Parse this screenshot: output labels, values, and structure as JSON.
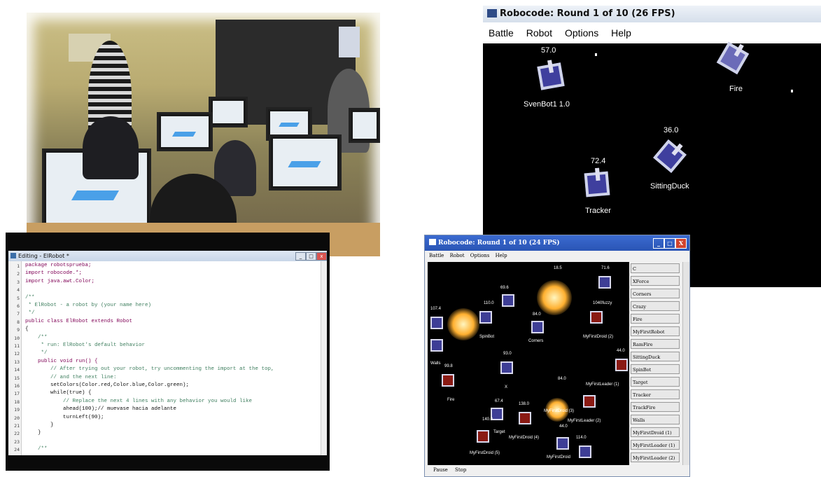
{
  "editor": {
    "title": "Editing - ElRobot *",
    "lines": [
      {
        "n": "1",
        "text": "package robotsprueba;"
      },
      {
        "n": "2",
        "text": "import robocode.*;"
      },
      {
        "n": "3",
        "text": "import java.awt.Color;"
      },
      {
        "n": "4",
        "text": ""
      },
      {
        "n": "5",
        "text": "/**"
      },
      {
        "n": "6",
        "text": " * ElRobot - a robot by (your name here)"
      },
      {
        "n": "7",
        "text": " */"
      },
      {
        "n": "8",
        "text": "public class ElRobot extends Robot"
      },
      {
        "n": "9",
        "text": "{"
      },
      {
        "n": "10",
        "text": "    /**"
      },
      {
        "n": "11",
        "text": "     * run: ElRobot's default behavior"
      },
      {
        "n": "12",
        "text": "     */"
      },
      {
        "n": "13",
        "text": "    public void run() {"
      },
      {
        "n": "14",
        "text": "        // After trying out your robot, try uncommenting the import at the top,"
      },
      {
        "n": "15",
        "text": "        // and the next line:"
      },
      {
        "n": "16",
        "text": "        setColors(Color.red,Color.blue,Color.green);"
      },
      {
        "n": "17",
        "text": "        while(true) {"
      },
      {
        "n": "18",
        "text": "            // Replace the next 4 lines with any behavior you would like"
      },
      {
        "n": "19",
        "text": "            ahead(100);// muevase hacia adelante"
      },
      {
        "n": "20",
        "text": "            turnLeft(90);"
      },
      {
        "n": "21",
        "text": "        }"
      },
      {
        "n": "22",
        "text": "    }"
      },
      {
        "n": "23",
        "text": ""
      },
      {
        "n": "24",
        "text": "    /**"
      }
    ]
  },
  "robocode_main": {
    "title": "Robocode: Round 1 of 10 (26 FPS)",
    "menu": [
      "Battle",
      "Robot",
      "Options",
      "Help"
    ],
    "robots": [
      {
        "name": "SvenBot1 1.0",
        "energy": "57.0"
      },
      {
        "name": "Fire",
        "energy": ""
      },
      {
        "name": "SittingDuck",
        "energy": "36.0"
      },
      {
        "name": "Tracker",
        "energy": "72.4"
      }
    ]
  },
  "robocode_small": {
    "title": "Robocode: Round 1 of 10 (24 FPS)",
    "menu": [
      "Battle",
      "Robot",
      "Options",
      "Help"
    ],
    "window_buttons": [
      "_",
      "□",
      "X"
    ],
    "arena_labels": [
      {
        "text": "71.6"
      },
      {
        "text": "18.5"
      },
      {
        "text": "69.6"
      },
      {
        "text": "107.4"
      },
      {
        "text": "110.0"
      },
      {
        "text": "84.0"
      },
      {
        "text": "1040fuzzy"
      },
      {
        "text": "SpinBot"
      },
      {
        "text": "Corners"
      },
      {
        "text": "MyFirstDroid (2)"
      },
      {
        "text": "44.0"
      },
      {
        "text": "93.0"
      },
      {
        "text": "Walls"
      },
      {
        "text": "99.8"
      },
      {
        "text": "Fire"
      },
      {
        "text": "84.0"
      },
      {
        "text": "X"
      },
      {
        "text": "MyFirstLeader (1)"
      },
      {
        "text": "67.4"
      },
      {
        "text": "138.0"
      },
      {
        "text": "MyFirstDroid (3)"
      },
      {
        "text": "140.0"
      },
      {
        "text": "MyFirstLeader (2)"
      },
      {
        "text": "MyFirstDroid (4)"
      },
      {
        "text": "44.0"
      },
      {
        "text": "114.0"
      },
      {
        "text": "Target"
      },
      {
        "text": "MyFirstDroid (5)"
      },
      {
        "text": "MyFirstDroid"
      }
    ],
    "robot_list": [
      "C",
      "XForce",
      "Corners",
      "Crazy",
      "Fire",
      "MyFirstRobot",
      "RamFire",
      "SittingDuck",
      "SpinBot",
      "Target",
      "Tracker",
      "TrackFire",
      "Walls",
      "MyFirstDroid (1)",
      "MyFirstLeader (1)",
      "MyFirstLeader (2)"
    ],
    "status": [
      "Pause",
      "Stop"
    ]
  }
}
